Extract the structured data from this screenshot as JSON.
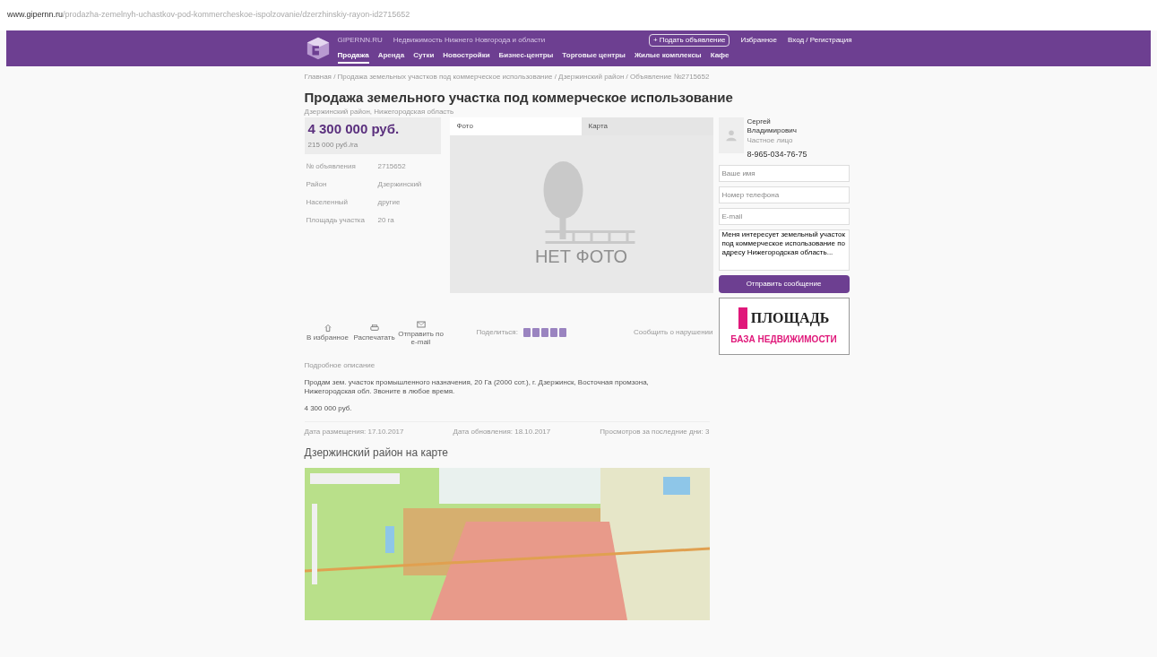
{
  "address_bar": {
    "domain": "www.gipernn.ru",
    "path": "/prodazha-zemelnyh-uchastkov-pod-kommercheskoe-ispolzovanie/dzerzhinskiy-rayon-id2715652"
  },
  "header": {
    "site_name": "GIPERNN.RU",
    "tagline": "Недвижимость Нижнего Новгорода и области",
    "post_button": "+ Подать объявление",
    "links": [
      "Избранное",
      "Вход / Регистрация"
    ],
    "nav": [
      {
        "label": "Продажа",
        "selected": true
      },
      {
        "label": "Аренда",
        "selected": false
      },
      {
        "label": "Сутки",
        "selected": false
      },
      {
        "label": "Новостройки",
        "selected": false
      },
      {
        "label": "Бизнес-центры",
        "selected": false
      },
      {
        "label": "Торговые центры",
        "selected": false
      },
      {
        "label": "Жилые комплексы",
        "selected": false
      },
      {
        "label": "Кафе",
        "selected": false
      }
    ]
  },
  "breadcrumbs": "Главная / Продажа земельных участков под коммерческое использование / Дзержинский район / Объявление №2715652",
  "title": "Продажа земельного участка под коммерческое использование",
  "location": "Дзержинский район, Нижегородская область",
  "price": {
    "total": "4 300 000 руб.",
    "per_unit": "215 000 руб./га"
  },
  "facts": [
    {
      "label": "№ объявления",
      "value": "2715652"
    },
    {
      "label": "Район",
      "value": "Дзержинский"
    },
    {
      "label": "Населенный",
      "value": "другие"
    },
    {
      "label": "Площадь участка",
      "value": "20 га"
    }
  ],
  "media_tabs": [
    {
      "label": "Фото",
      "selected": true
    },
    {
      "label": "Карта",
      "selected": false
    }
  ],
  "no_photo": "НЕТ ФОТО",
  "actions": [
    "В избранное",
    "Распечатать",
    "Отправить по e-mail"
  ],
  "share_label": "Поделиться:",
  "report_link": "Сообщить о нарушении",
  "description_heading": "Подробное описание",
  "description": "Продам зем. участок промышленного назначения, 20 Га (2000 сот.), г. Дзержинск, Восточная промзона, Нижегородская обл. Звоните в любое время.",
  "description_price": "4 300 000 руб.",
  "dates": [
    "Дата размещения: 17.10.2017",
    "Дата обновления: 18.10.2017",
    "Просмотров за последние дни: 3"
  ],
  "map_heading": "Дзержинский район на карте",
  "contact": {
    "name": "Сергей Владимирович",
    "role": "Частное лицо",
    "phone": "8-965-034-76-75"
  },
  "form": {
    "fields": [
      {
        "placeholder": "Ваше имя"
      },
      {
        "placeholder": "Номер телефона"
      },
      {
        "placeholder": "E-mail"
      }
    ],
    "message": "Меня интересует земельный участок под коммерческое использование по адресу Нижегородская область...",
    "button": "Отправить сообщение"
  },
  "banner": {
    "line1": "ПЛОЩАДЬ",
    "line2": "БАЗА НЕДВИЖИМОСТИ"
  }
}
